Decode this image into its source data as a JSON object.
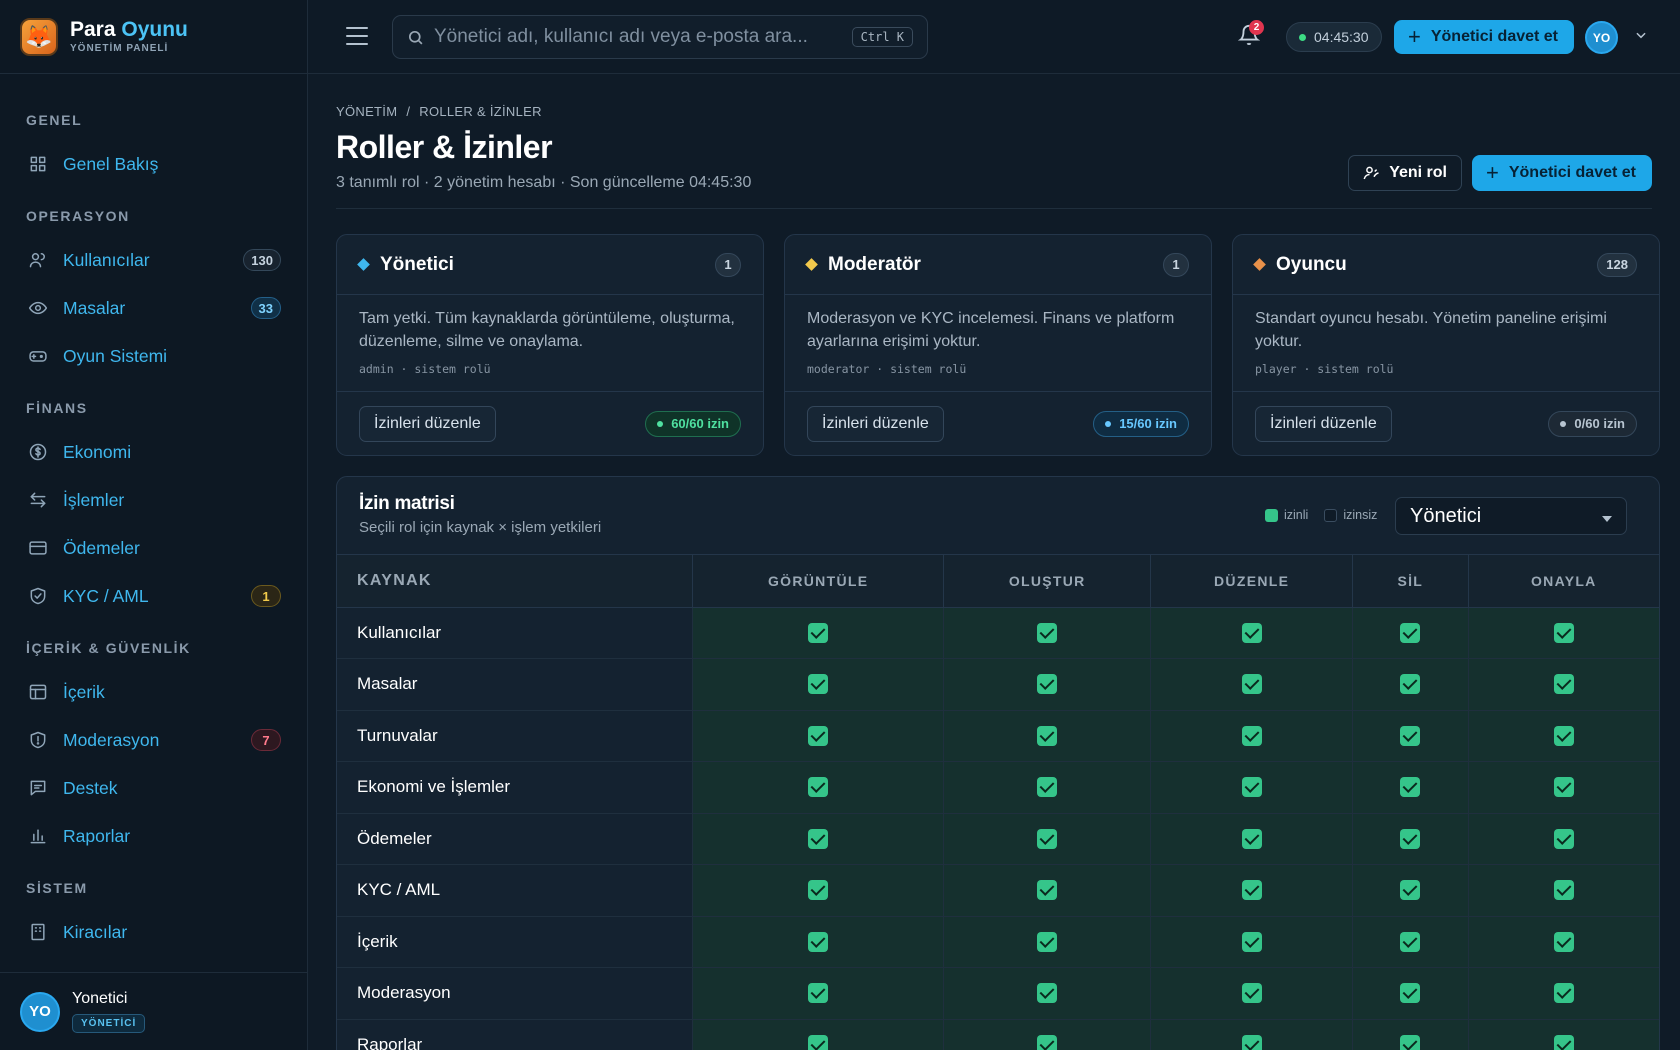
{
  "brand": {
    "name_part1": "Para",
    "name_part2": "Oyunu",
    "subtitle": "YÖNETİM PANELİ"
  },
  "sidebar": {
    "sections": [
      {
        "title": "GENEL",
        "items": [
          {
            "label": "Genel Bakış",
            "icon": "grid-icon"
          }
        ]
      },
      {
        "title": "OPERASYON",
        "items": [
          {
            "label": "Kullanıcılar",
            "icon": "users-icon",
            "count": "130"
          },
          {
            "label": "Masalar",
            "icon": "eye-icon",
            "count": "33"
          },
          {
            "label": "Oyun Sistemi",
            "icon": "gamepad-icon"
          }
        ]
      },
      {
        "title": "FİNANS",
        "items": [
          {
            "label": "Ekonomi",
            "icon": "coin-icon"
          },
          {
            "label": "İşlemler",
            "icon": "arrows-icon"
          },
          {
            "label": "Ödemeler",
            "icon": "card-icon"
          },
          {
            "label": "KYC / AML",
            "icon": "shield-check-icon",
            "count": "1"
          }
        ]
      },
      {
        "title": "İÇERİK & GÜVENLİK",
        "items": [
          {
            "label": "İçerik",
            "icon": "layout-icon"
          },
          {
            "label": "Moderasyon",
            "icon": "shield-alert-icon",
            "count": "7"
          },
          {
            "label": "Destek",
            "icon": "message-icon"
          },
          {
            "label": "Raporlar",
            "icon": "bar-chart-icon"
          }
        ]
      },
      {
        "title": "SİSTEM",
        "items": [
          {
            "label": "Kiracılar",
            "icon": "building-icon"
          }
        ]
      }
    ],
    "user": {
      "initials": "YO",
      "name": "Yonetici",
      "role": "YÖNETİCİ"
    }
  },
  "topbar": {
    "search_placeholder": "Yönetici adı, kullanıcı adı veya e-posta ara...",
    "shortcut": "Ctrl K",
    "notif_count": "2",
    "clock": "04:45:30",
    "invite_label": "Yönetici davet et",
    "avatar_initials": "YO"
  },
  "page": {
    "breadcrumb": [
      "YÖNETİM",
      "ROLLER & İZİNLER"
    ],
    "title": "Roller & İzinler",
    "subtitle": "3 tanımlı rol · 2 yönetim hesabı · Son güncelleme 04:45:30",
    "new_role_label": "Yeni rol",
    "invite_label": "Yönetici davet et"
  },
  "roles": [
    {
      "name": "Yönetici",
      "count": "1",
      "color": "#3fb7ee",
      "desc": "Tam yetki. Tüm kaynaklarda görüntüleme, oluşturma, düzenleme, silme ve onaylama.",
      "meta": "admin · sistem rolü",
      "edit_label": "İzinleri düzenle",
      "perm": "60/60 izin",
      "perm_style": "green"
    },
    {
      "name": "Moderatör",
      "count": "1",
      "color": "#f2c94c",
      "desc": "Moderasyon ve KYC incelemesi. Finans ve platform ayarlarına erişimi yoktur.",
      "meta": "moderator · sistem rolü",
      "edit_label": "İzinleri düzenle",
      "perm": "15/60 izin",
      "perm_style": "blue"
    },
    {
      "name": "Oyuncu",
      "count": "128",
      "color": "#e8914a",
      "desc": "Standart oyuncu hesabı. Yönetim paneline erişimi yoktur.",
      "meta": "player · sistem rolü",
      "edit_label": "İzinleri düzenle",
      "perm": "0/60 izin",
      "perm_style": "gray"
    }
  ],
  "matrix": {
    "title": "İzin matrisi",
    "subtitle": "Seçili rol için kaynak × işlem yetkileri",
    "legend_on": "izinli",
    "legend_off": "izinsiz",
    "selected_role": "Yönetici",
    "columns": [
      "KAYNAK",
      "GÖRÜNTÜLE",
      "OLUŞTUR",
      "DÜZENLE",
      "SİL",
      "ONAYLA"
    ],
    "rows": [
      {
        "resource": "Kullanıcılar",
        "perms": [
          true,
          true,
          true,
          true,
          true
        ]
      },
      {
        "resource": "Masalar",
        "perms": [
          true,
          true,
          true,
          true,
          true
        ]
      },
      {
        "resource": "Turnuvalar",
        "perms": [
          true,
          true,
          true,
          true,
          true
        ]
      },
      {
        "resource": "Ekonomi ve İşlemler",
        "perms": [
          true,
          true,
          true,
          true,
          true
        ]
      },
      {
        "resource": "Ödemeler",
        "perms": [
          true,
          true,
          true,
          true,
          true
        ]
      },
      {
        "resource": "KYC / AML",
        "perms": [
          true,
          true,
          true,
          true,
          true
        ]
      },
      {
        "resource": "İçerik",
        "perms": [
          true,
          true,
          true,
          true,
          true
        ]
      },
      {
        "resource": "Moderasyon",
        "perms": [
          true,
          true,
          true,
          true,
          true
        ]
      },
      {
        "resource": "Raporlar",
        "perms": [
          true,
          true,
          true,
          true,
          true
        ]
      }
    ]
  }
}
